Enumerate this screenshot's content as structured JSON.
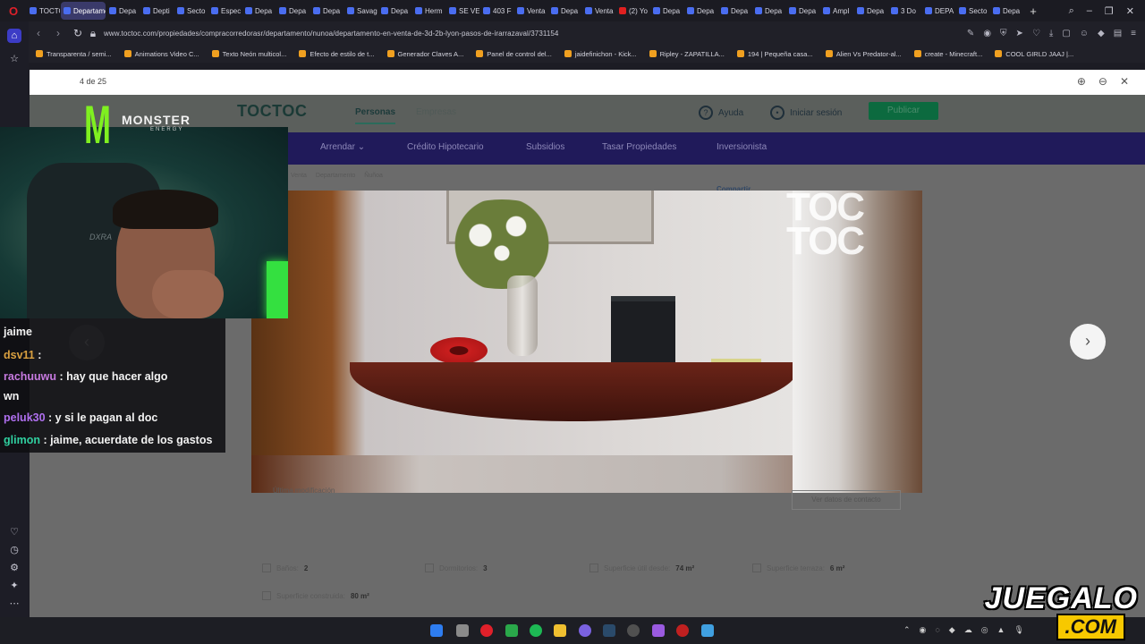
{
  "browser": {
    "tabs": [
      {
        "label": "TOCTO",
        "active": false
      },
      {
        "label": "Departame",
        "active": true
      },
      {
        "label": "Depa",
        "active": false
      },
      {
        "label": "Depti",
        "active": false
      },
      {
        "label": "Secto",
        "active": false
      },
      {
        "label": "Espec",
        "active": false
      },
      {
        "label": "Depa",
        "active": false
      },
      {
        "label": "Depa",
        "active": false
      },
      {
        "label": "Depa",
        "active": false
      },
      {
        "label": "Savag",
        "active": false
      },
      {
        "label": "Depa",
        "active": false
      },
      {
        "label": "Herm",
        "active": false
      },
      {
        "label": "SE VE",
        "active": false
      },
      {
        "label": "403 F",
        "active": false
      },
      {
        "label": "Venta",
        "active": false
      },
      {
        "label": "Depa",
        "active": false
      },
      {
        "label": "Venta",
        "active": false
      },
      {
        "label": "(2) Yo",
        "active": false,
        "youtube": true
      },
      {
        "label": "Depa",
        "active": false
      },
      {
        "label": "Depa",
        "active": false
      },
      {
        "label": "Depa",
        "active": false
      },
      {
        "label": "Depa",
        "active": false
      },
      {
        "label": "Depa",
        "active": false
      },
      {
        "label": "Ampl",
        "active": false
      },
      {
        "label": "Depa",
        "active": false
      },
      {
        "label": "3 Do",
        "active": false
      },
      {
        "label": "DEPA",
        "active": false
      },
      {
        "label": "Secto",
        "active": false
      },
      {
        "label": "Depa",
        "active": false
      }
    ],
    "url": "www.toctoc.com/propiedades/compracorredorasr/departamento/nunoa/departamento-en-venta-de-3d-2b-lyon-pasos-de-irarrazaval/3731154",
    "bookmarks": [
      "Transparenta / semi...",
      "Animations Video C...",
      "Texto Neón multicol...",
      "Efecto de estilo de t...",
      "Generador Claves A...",
      "Panel de control del...",
      "jaidefinichon - Kick...",
      "Ripley - ZAPATILLA...",
      "194 | Pequeña casa...",
      "Alien Vs Predator-al...",
      "create - Minecraft...",
      "COOL GIRLD JAAJ |..."
    ]
  },
  "gallery": {
    "counter": "4 de 25"
  },
  "site": {
    "brand": "TOCTOC",
    "nav_personas": "Personas",
    "nav_empresas": "Empresas",
    "ayuda": "Ayuda",
    "login": "Iniciar sesión",
    "publicar": "Publicar",
    "menu": [
      "Arrendar",
      "Crédito Hipotecario",
      "Subsidios",
      "Tasar Propiedades",
      "Inversionista"
    ],
    "breadcrumb": [
      "Venta",
      "Departamento",
      "Ñuñoa"
    ],
    "share": "Compartir",
    "watermark_line1": "TOC",
    "watermark_line2": "TOC",
    "ultima": "Última modificación",
    "contacto": "Ver datos de contacto",
    "features": {
      "banos_label": "Baños:",
      "banos_value": "2",
      "dormitorios_label": "Dormitorios:",
      "dormitorios_value": "3",
      "sup_util_label": "Superficie útil desde:",
      "sup_util_value": "74 m²",
      "sup_terraza_label": "Superficie terraza:",
      "sup_terraza_value": "6 m²",
      "sup_construida_label": "Superficie construida:",
      "sup_construida_value": "80 m²"
    }
  },
  "stream": {
    "monster_brand": "MONSTER",
    "monster_sub": "ENERGY",
    "chair_brand": "DXRA",
    "chat": [
      {
        "user": "",
        "text": "jaime",
        "color": "#f2f2f2"
      },
      {
        "user": "dsv11",
        "text": " :",
        "color": "#d9a040"
      },
      {
        "user": "rachuuwu",
        "text": " : hay que hacer algo",
        "color": "#c77ae0"
      },
      {
        "user": "",
        "text": "wn",
        "color": "#f2f2f2"
      },
      {
        "user": "peluk30",
        "text": " : y si le pagan al doc",
        "color": "#b070f0"
      },
      {
        "user": "glimon",
        "text": " : jaime, acuerdate de los gastos",
        "color": "#30d0a0"
      }
    ],
    "watermark_top": "JUEGALO",
    "watermark_bottom": ".COM"
  },
  "colors": {
    "accent": "#3c3cc6",
    "site_menu": "#201a5a",
    "publish": "#0c6a3f"
  }
}
